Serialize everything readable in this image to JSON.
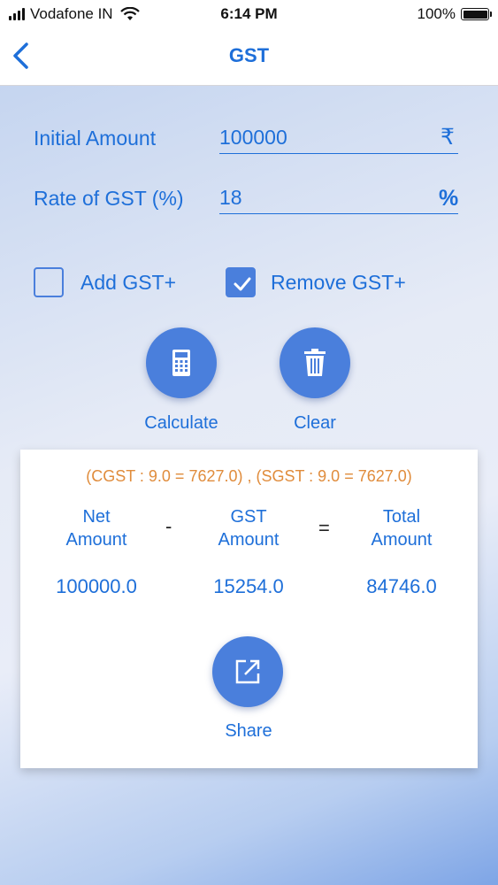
{
  "status": {
    "carrier": "Vodafone IN",
    "time": "6:14 PM",
    "battery": "100%",
    "battery_level": 1.0
  },
  "nav": {
    "title": "GST",
    "back_icon": "chevron-left-icon"
  },
  "form": {
    "initial_amount_label": "Initial Amount",
    "initial_amount_value": "100000",
    "initial_amount_suffix": "₹",
    "rate_label": "Rate of GST (%)",
    "rate_value": "18",
    "rate_suffix": "%"
  },
  "options": {
    "add_label": "Add GST+",
    "add_checked": false,
    "remove_label": "Remove GST+",
    "remove_checked": true
  },
  "actions": {
    "calculate_label": "Calculate",
    "calculate_icon": "calculator-icon",
    "clear_label": "Clear",
    "clear_icon": "trash-icon"
  },
  "result": {
    "split": "(CGST : 9.0 = 7627.0) , (SGST : 9.0 = 7627.0)",
    "net_label_1": "Net",
    "net_label_2": "Amount",
    "minus": "-",
    "gst_label_1": "GST",
    "gst_label_2": "Amount",
    "equals": "=",
    "total_label_1": "Total",
    "total_label_2": "Amount",
    "net_value": "100000.0",
    "gst_value": "15254.0",
    "total_value": "84746.0",
    "share_label": "Share",
    "share_icon": "share-icon"
  },
  "colors": {
    "accent": "#1e6fd9",
    "button": "#4a7fdc",
    "split_text": "#e08c3c"
  }
}
